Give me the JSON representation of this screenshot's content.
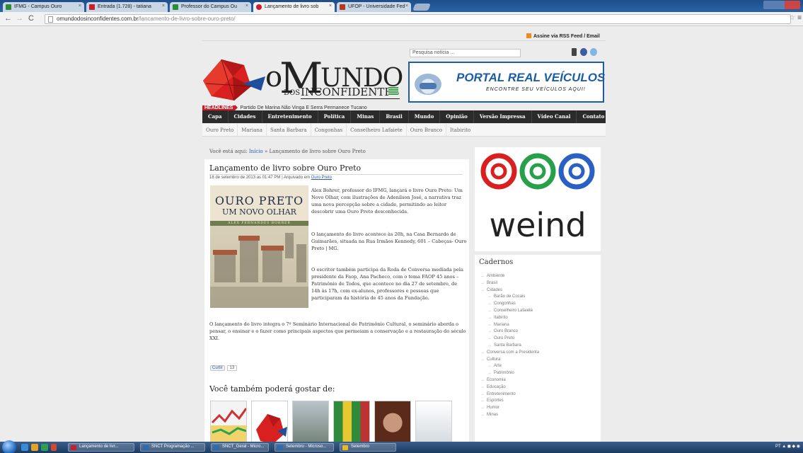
{
  "browser": {
    "tabs": [
      {
        "label": "IFMG - Campus Ouro",
        "color": "#2e8b3a"
      },
      {
        "label": "Entrada (1.728) - tatiana",
        "color": "#c8202a"
      },
      {
        "label": "Professor do Campus Ou",
        "color": "#2e8b3a"
      },
      {
        "label": "Lançamento de livro sob",
        "color": "#c8202a"
      },
      {
        "label": "UFOP - Universidade Fed",
        "color": "#b5381f"
      }
    ],
    "url_host": "omundodosinconfidentes.com.br",
    "url_path": "/lancamento-de-livro-sobre-ouro-preto/"
  },
  "header": {
    "rss": "Assine via RSS Feed / Email",
    "logo": {
      "o": "o",
      "m": "M",
      "undo": "UNDO",
      "dos": "DOS",
      "inconfidentes": "INCONFIDENTES"
    },
    "search_placeholder": "Pesquisa notícia ...",
    "banner": {
      "title": "PORTAL REAL VEÍCULOS",
      "tagline": "ENCONTRE SEU VEÍCULOS AQUI!"
    },
    "headlines_label": "HEADLINES",
    "headline_text": "Partido De Marina Não Vinga E Serra Permanece Tucano"
  },
  "nav": {
    "main": [
      "Capa",
      "Cidades",
      "Entretenimento",
      "Política",
      "Minas",
      "Brasil",
      "Mundo",
      "Opinião",
      "Versão Impressa",
      "Vídeo Canal",
      "Contato"
    ],
    "sub": [
      "Ouro Preto",
      "Mariana",
      "Santa Barbara",
      "Congonhas",
      "Conselheiro Lafaiete",
      "Ouro Branco",
      "Itabirito"
    ]
  },
  "breadcrumb": {
    "prefix": "Você está aqui:",
    "home": "Início",
    "sep": "»",
    "current": "Lançamento de livro sobre Ouro Preto"
  },
  "article": {
    "title": "Lançamento de livro sobre Ouro Preto",
    "meta_prefix": "18 de setembro de 2013 as 01:47 PM | Arquivado em",
    "meta_category": "Ouro Preto",
    "book": {
      "title": "OURO PRETO",
      "subtitle": "UM NOVO OLHAR",
      "author": "ALEX FERNANDES BOHRER"
    },
    "p1": "Alex Bohrer, professor do IFMG, lançará o livro Ouro Preto: Um Novo Olhar, com ilustrações de Adenilson José, a narrativa traz uma nova percepção sobre a cidade, permitindo ao leitor descobrir uma Ouro Preto desconhecida.",
    "p2": "O lançamento do livro acontece às 20h, na Casa Bernardo de Guimarães, situada na Rua Irmãos Kennedy, 601 – Cabeças- Ouro Preto | MG.",
    "p3": "O escritor também participa da Roda de Conversa mediada pela presidente da Faop, Ana Pacheco, com o tema FAOP 45 anos – Patrimônio de Todos, que acontece no dia 27 de setembro, de 14h às 17h, com ex-alunos, professores e pessoas que participaram da história de 45 anos da Fundação.",
    "p4": "O lançamento do livro integra o 7º Seminário Internacional de Patrimônio Cultural, o seminário aborda o pensar, o ensinar e o fazer como principais aspectos que permeiam a conservação e a restauração do século XXI.",
    "like_label": "Curtir",
    "like_count": "13",
    "related_heading": "Você também poderá gostar de:"
  },
  "sidebar": {
    "ad_text": "weind",
    "cadernos_title": "Cadernos",
    "cadernos": [
      {
        "label": "Ambiente",
        "sub": false
      },
      {
        "label": "Brasil",
        "sub": false
      },
      {
        "label": "Cidades",
        "sub": false
      },
      {
        "label": "Barão de Cocais",
        "sub": true
      },
      {
        "label": "Congonhas",
        "sub": true
      },
      {
        "label": "Conselheiro Lafaiete",
        "sub": true
      },
      {
        "label": "Itabirito",
        "sub": true
      },
      {
        "label": "Mariana",
        "sub": true
      },
      {
        "label": "Ouro Branco",
        "sub": true
      },
      {
        "label": "Ouro Preto",
        "sub": true
      },
      {
        "label": "Santa Barbara",
        "sub": true
      },
      {
        "label": "Conversa com a Presidenta",
        "sub": false
      },
      {
        "label": "Cultura",
        "sub": false
      },
      {
        "label": "Arte",
        "sub": true
      },
      {
        "label": "Patrimônio",
        "sub": true
      },
      {
        "label": "Economia",
        "sub": false
      },
      {
        "label": "Educação",
        "sub": false
      },
      {
        "label": "Entretenimento",
        "sub": false
      },
      {
        "label": "Esportes",
        "sub": false
      },
      {
        "label": "Humor",
        "sub": false
      },
      {
        "label": "Minas",
        "sub": false
      }
    ]
  },
  "taskbar": {
    "windows": [
      {
        "label": "Lançamento de livr...",
        "color": "#c8202a"
      },
      {
        "label": "SNCT Programação ...",
        "color": "#2b6cb0"
      },
      {
        "label": "SNCT_Geral - Micro...",
        "color": "#2b6cb0"
      },
      {
        "label": "Setembro - Microso...",
        "color": "#2b6cb0"
      },
      {
        "label": "Setembro",
        "color": "#e8b923"
      }
    ],
    "tray_text": "PT"
  }
}
